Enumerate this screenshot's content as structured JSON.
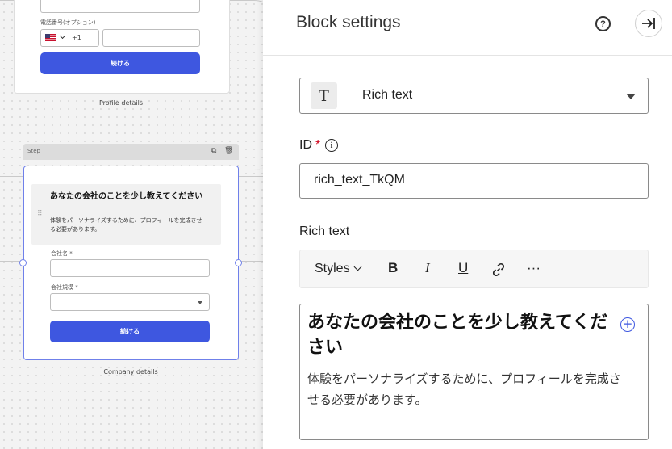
{
  "canvas": {
    "profile_card": {
      "phone_label": "電話番号(オプション)",
      "country_code": "+1",
      "continue_label": "続ける",
      "caption": "Profile details"
    },
    "step": {
      "header_label": "Step",
      "hero_title": "あなたの会社のことを少し教えてください",
      "hero_subtitle": "体験をパーソナライズするために、プロフィールを完成させる必要があります。",
      "company_name_label": "会社名 *",
      "company_size_label": "会社規模 *",
      "continue_label": "続ける",
      "caption": "Company details"
    }
  },
  "panel": {
    "title": "Block settings",
    "block_type": {
      "icon": "T",
      "label": "Rich text"
    },
    "id_field": {
      "label": "ID",
      "required_mark": "*",
      "value": "rich_text_TkQM"
    },
    "rich_text": {
      "label": "Rich text",
      "toolbar": {
        "styles": "Styles",
        "bold": "B",
        "italic": "I",
        "underline": "U",
        "more": "···"
      },
      "content_title": "あなたの会社のことを少し教えてください",
      "content_body": "体験をパーソナライズするために、プロフィールを完成させる必要があります。"
    }
  },
  "colors": {
    "accent": "#3e57e0",
    "selection": "#6f80ea",
    "required": "#d0021b"
  }
}
